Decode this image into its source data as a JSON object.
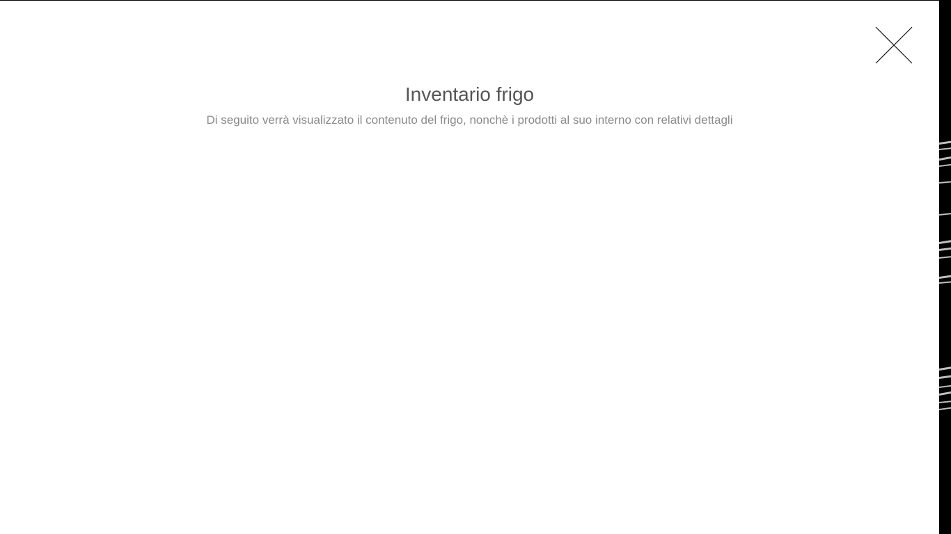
{
  "modal": {
    "title": "Inventario frigo",
    "subtitle": "Di seguito verrà visualizzato il contenuto del frigo, nonchè i prodotti al suo interno con relativi dettagli",
    "close_icon": "close-icon"
  },
  "colors": {
    "backdrop": "#000000",
    "modal_background": "#ffffff",
    "title_text": "#555555",
    "subtitle_text": "#8a8a8a"
  }
}
